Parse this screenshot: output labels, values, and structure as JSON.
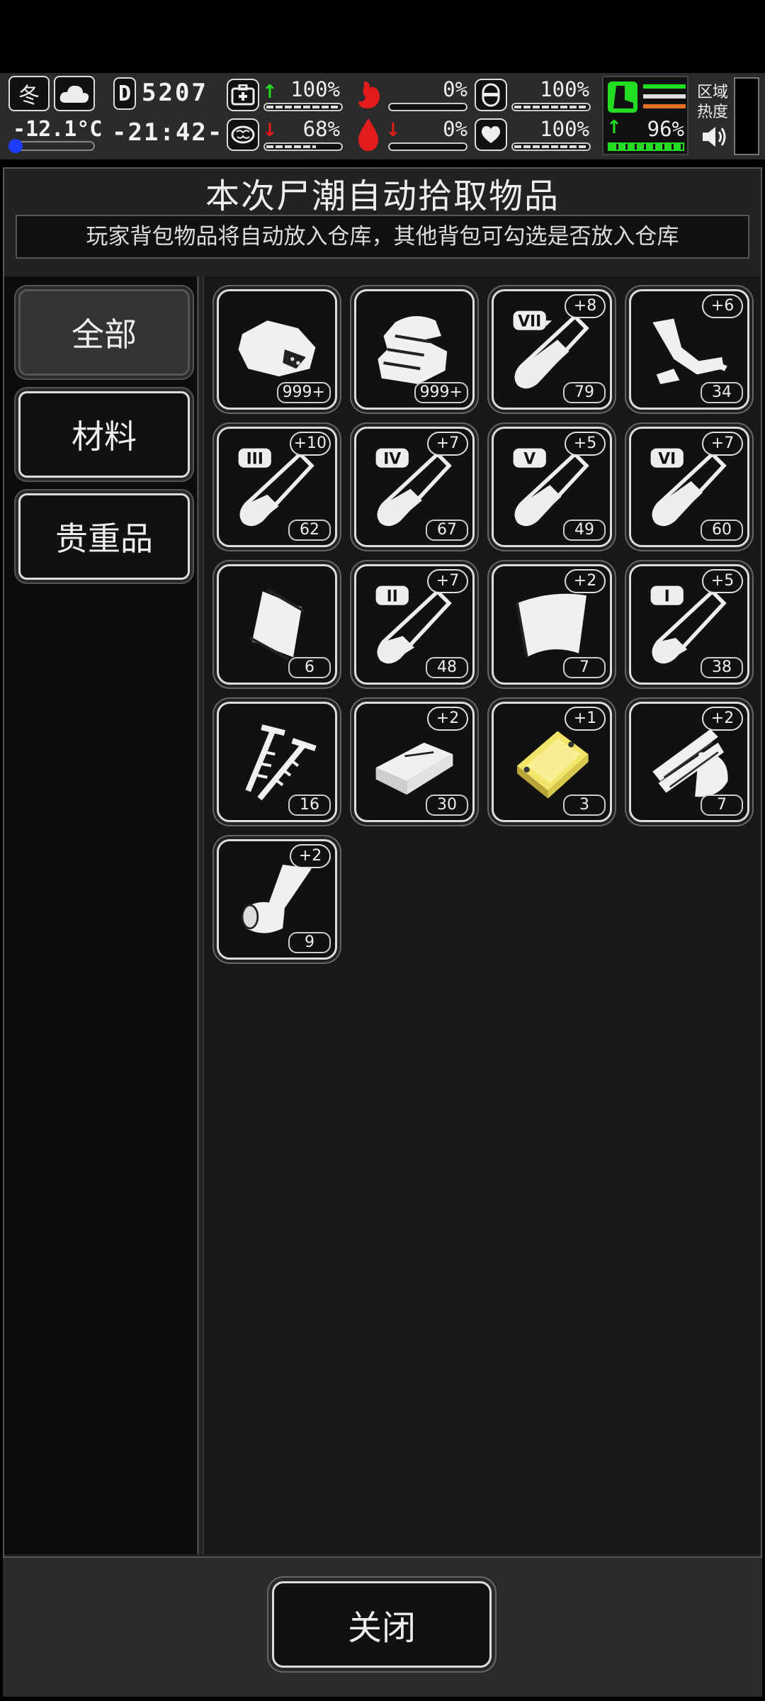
{
  "hud": {
    "season": "冬",
    "weather_icon": "cloud-icon",
    "temperature": "-12.1°C",
    "day_counter": "5207",
    "day_prefix": "D",
    "clock": "-21:42-",
    "stats": [
      {
        "icon": "medkit-icon",
        "value": "100%",
        "trend": "up",
        "level": 1.0
      },
      {
        "icon": "stomach-icon",
        "value": "0%",
        "trend": "none",
        "level": 0.0
      },
      {
        "icon": "shield-icon",
        "value": "100%",
        "trend": "none",
        "level": 1.0
      },
      {
        "icon": "brain-icon",
        "value": "68%",
        "trend": "down",
        "level": 0.68
      },
      {
        "icon": "blood-drop-icon",
        "value": "0%",
        "trend": "down",
        "level": 0.0
      },
      {
        "icon": "heart-icon",
        "value": "100%",
        "trend": "none",
        "level": 1.0
      }
    ],
    "stamina": {
      "value": "96%",
      "trend": "up",
      "level": 0.96
    },
    "area_heat_label": "区域热度",
    "sound_icon": "speaker-icon",
    "colors": {
      "green": "#22dd22",
      "red": "#e21b1b",
      "orange": "#e07020"
    }
  },
  "dialog": {
    "title": "本次尸潮自动拾取物品",
    "subtitle": "玩家背包物品将自动放入仓库，其他背包可勾选是否放入仓库",
    "tabs": [
      {
        "label": "全部",
        "active": true
      },
      {
        "label": "材料",
        "active": false
      },
      {
        "label": "贵重品",
        "active": false
      }
    ],
    "items": [
      {
        "icon": "rock-ore-icon",
        "qty": "999+",
        "plus": ""
      },
      {
        "icon": "cloth-icon",
        "qty": "999+",
        "plus": ""
      },
      {
        "icon": "test-tube-vii-icon",
        "tier": "VII",
        "qty": "79",
        "plus": "+8",
        "fill": 0.55
      },
      {
        "icon": "scrap-parts-icon",
        "qty": "34",
        "plus": "+6"
      },
      {
        "icon": "test-tube-iii-icon",
        "tier": "III",
        "qty": "62",
        "plus": "+10",
        "fill": 0.35
      },
      {
        "icon": "test-tube-iv-icon",
        "tier": "IV",
        "qty": "67",
        "plus": "+7",
        "fill": 0.4
      },
      {
        "icon": "test-tube-v-icon",
        "tier": "V",
        "qty": "49",
        "plus": "+5",
        "fill": 0.45
      },
      {
        "icon": "test-tube-vi-icon",
        "tier": "VI",
        "qty": "60",
        "plus": "+7",
        "fill": 0.5
      },
      {
        "icon": "plastic-bag-icon",
        "qty": "6",
        "plus": ""
      },
      {
        "icon": "test-tube-ii-icon",
        "tier": "II",
        "qty": "48",
        "plus": "+7",
        "fill": 0.3
      },
      {
        "icon": "leather-sheet-icon",
        "qty": "7",
        "plus": "+2"
      },
      {
        "icon": "test-tube-i-icon",
        "tier": "I",
        "qty": "38",
        "plus": "+5",
        "fill": 0.25
      },
      {
        "icon": "screws-icon",
        "qty": "16",
        "plus": ""
      },
      {
        "icon": "wood-plank-icon",
        "qty": "30",
        "plus": "+2"
      },
      {
        "icon": "gold-plate-icon",
        "qty": "3",
        "plus": "+1"
      },
      {
        "icon": "wood-scraps-icon",
        "qty": "7",
        "plus": "+2"
      },
      {
        "icon": "bandage-roll-icon",
        "qty": "9",
        "plus": "+2"
      }
    ],
    "close_label": "关闭"
  }
}
